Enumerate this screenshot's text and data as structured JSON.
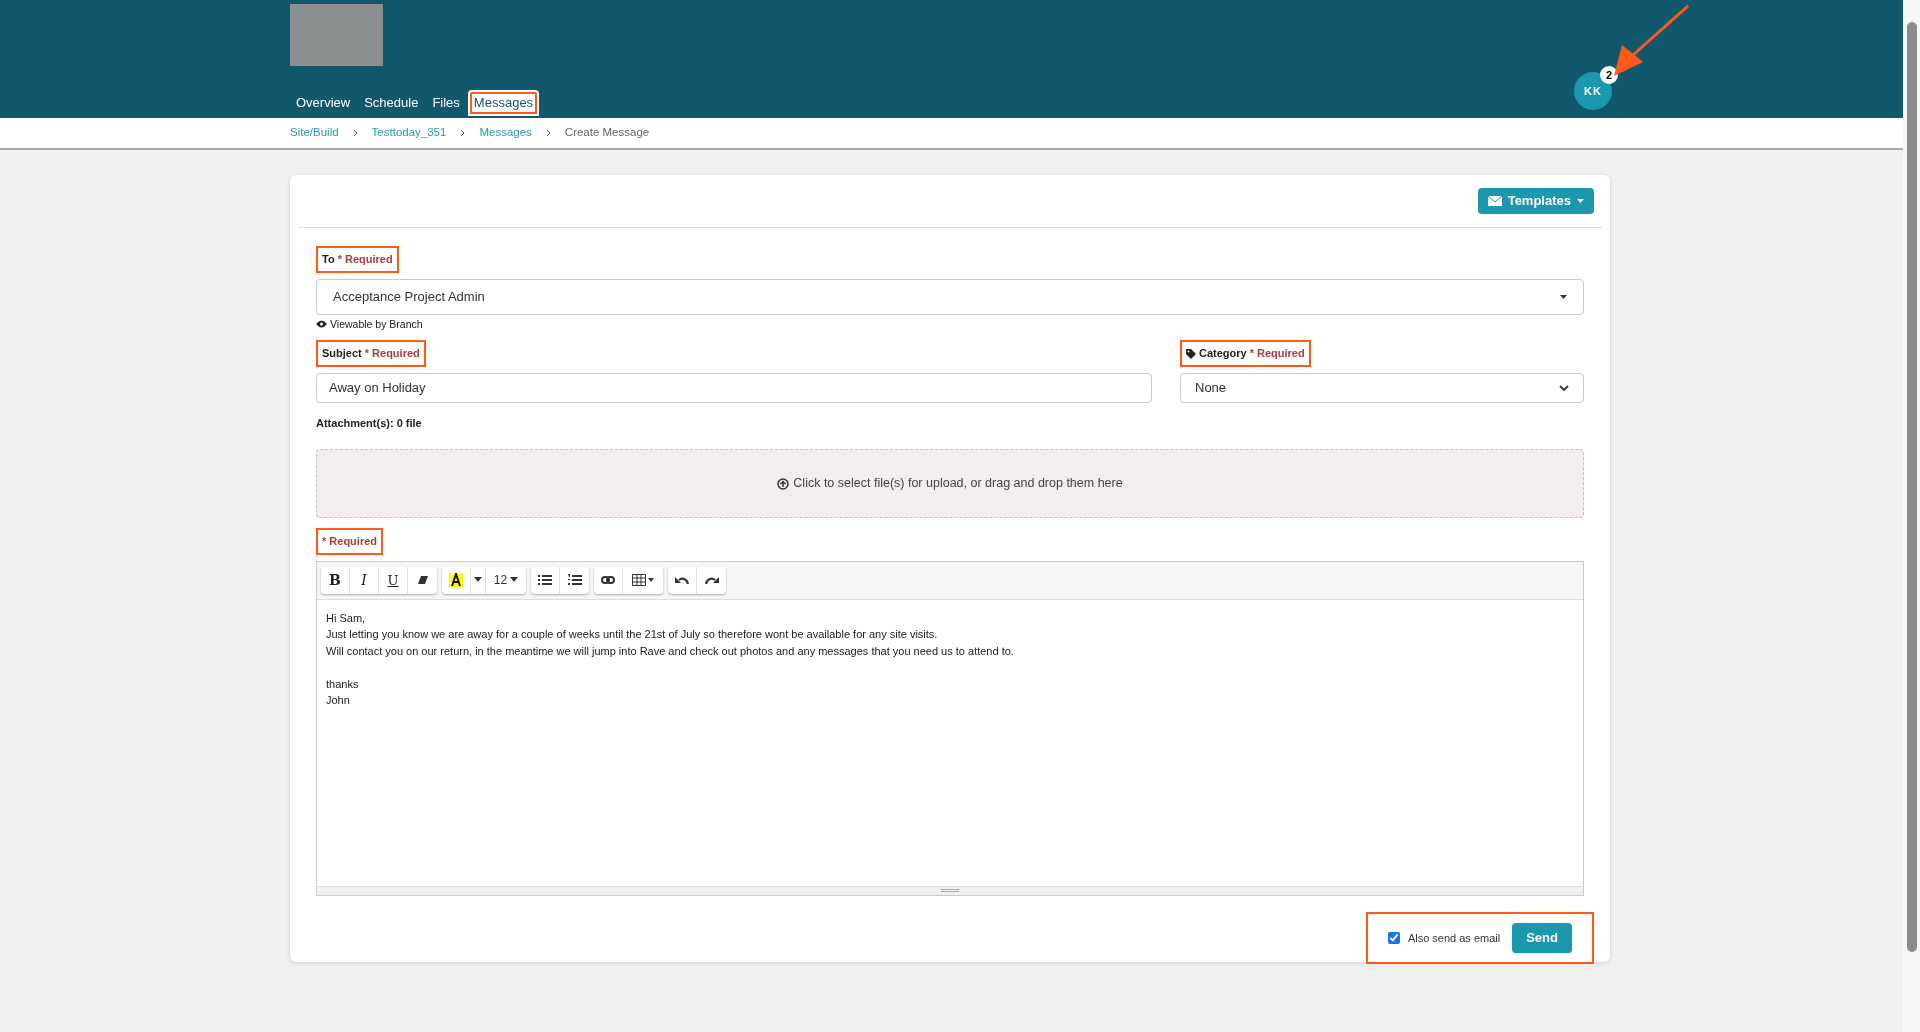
{
  "header": {
    "nav": [
      {
        "label": "Overview",
        "selected": false,
        "highlighted": false
      },
      {
        "label": "Schedule",
        "selected": false,
        "highlighted": false
      },
      {
        "label": "Files",
        "selected": false,
        "highlighted": false
      },
      {
        "label": "Messages",
        "selected": true,
        "highlighted": true
      }
    ],
    "avatar": {
      "initials": "KK",
      "badge": "2"
    }
  },
  "breadcrumb": [
    {
      "label": "Site/Build",
      "kind": "link"
    },
    {
      "label": "Testtoday_351",
      "kind": "link"
    },
    {
      "label": "Messages",
      "kind": "link"
    },
    {
      "label": "Create Message",
      "kind": "current"
    }
  ],
  "templates_button": "Templates",
  "to": {
    "label": "To",
    "required": "* Required",
    "highlighted": true,
    "value": "Acceptance Project Admin",
    "note": "Viewable by Branch"
  },
  "subject": {
    "label": "Subject",
    "required": "* Required",
    "highlighted": true,
    "value": "Away on Holiday"
  },
  "category": {
    "label": "Category",
    "required": "* Required",
    "highlighted": true,
    "value": "None"
  },
  "attachments": "Attachment(s): 0 file",
  "upload_hint": "Click to select file(s) for upload, or drag and drop them here",
  "body": {
    "required": "* Required",
    "highlighted": true,
    "toolbar": [
      [
        {
          "kind": "bold",
          "label": "B"
        },
        {
          "kind": "italic",
          "label": "I"
        },
        {
          "kind": "underline",
          "label": "U"
        },
        {
          "kind": "eraser"
        }
      ],
      [
        {
          "kind": "color"
        },
        {
          "kind": "caret"
        },
        {
          "kind": "size",
          "label": "12"
        }
      ],
      [
        {
          "kind": "ul"
        },
        {
          "kind": "ol"
        }
      ],
      [
        {
          "kind": "link"
        },
        {
          "kind": "table"
        }
      ],
      [
        {
          "kind": "undo"
        },
        {
          "kind": "redo"
        }
      ]
    ],
    "paragraphs": [
      [
        "Hi Sam,",
        "Just letting you know we are away for a couple of weeks until the 21st of July so therefore wont be available for any site visits.",
        "Will contact you on our return, in the meantime we will jump into Rave and check out photos and any messages that you need us to attend to."
      ],
      [
        "thanks",
        "John"
      ]
    ]
  },
  "footer": {
    "highlighted": true,
    "send_email": {
      "label": "Also send as email",
      "checked": true
    },
    "send": "Send"
  }
}
